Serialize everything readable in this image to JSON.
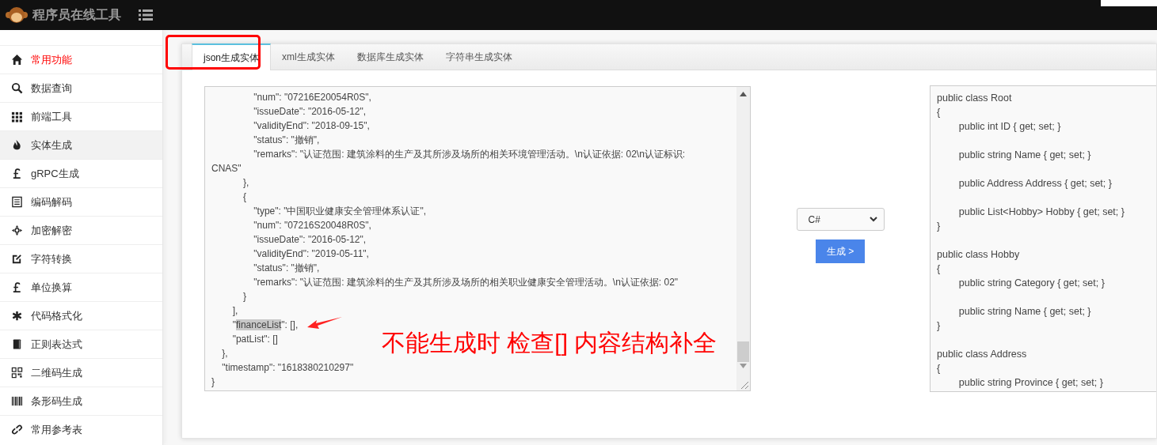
{
  "header": {
    "title": "程序员在线工具"
  },
  "sidebar": {
    "items": [
      {
        "label": "常用功能",
        "kind": "category",
        "selected": false
      },
      {
        "label": "数据查询",
        "kind": "link",
        "selected": false
      },
      {
        "label": "前端工具",
        "kind": "link",
        "selected": false
      },
      {
        "label": "实体生成",
        "kind": "link",
        "selected": true
      },
      {
        "label": "gRPC生成",
        "kind": "link",
        "selected": false
      },
      {
        "label": "编码解码",
        "kind": "link",
        "selected": false
      },
      {
        "label": "加密解密",
        "kind": "link",
        "selected": false
      },
      {
        "label": "字符转换",
        "kind": "link",
        "selected": false
      },
      {
        "label": "单位换算",
        "kind": "link",
        "selected": false
      },
      {
        "label": "代码格式化",
        "kind": "link",
        "selected": false
      },
      {
        "label": "正则表达式",
        "kind": "link",
        "selected": false
      },
      {
        "label": "二维码生成",
        "kind": "link",
        "selected": false
      },
      {
        "label": "条形码生成",
        "kind": "link",
        "selected": false
      },
      {
        "label": "常用参考表",
        "kind": "link",
        "selected": false
      }
    ]
  },
  "tabs": [
    {
      "label": "json生成实体",
      "selected": true
    },
    {
      "label": "xml生成实体",
      "selected": false
    },
    {
      "label": "数据库生成实体",
      "selected": false
    },
    {
      "label": "字符串生成实体",
      "selected": false
    }
  ],
  "input_editor": {
    "lines": [
      {
        "text": "                \"num\": \"07216E20054R0S\","
      },
      {
        "text": "                \"issueDate\": \"2016-05-12\","
      },
      {
        "text": "                \"validityEnd\": \"2018-09-15\","
      },
      {
        "text": "                \"status\": \"撤销\","
      },
      {
        "text": "                \"remarks\": \"认证范围: 建筑涂料的生产及其所涉及场所的相关环境管理活动。\\n认证依据: 02\\n认证标识:"
      },
      {
        "text": "CNAS\""
      },
      {
        "text": "            },"
      },
      {
        "text": "            {"
      },
      {
        "text": "                \"type\": \"中国职业健康安全管理体系认证\","
      },
      {
        "text": "                \"num\": \"07216S20048R0S\","
      },
      {
        "text": "                \"issueDate\": \"2016-05-12\","
      },
      {
        "text": "                \"validityEnd\": \"2019-05-11\","
      },
      {
        "text": "                \"status\": \"撤销\","
      },
      {
        "text": "                \"remarks\": \"认证范围: 建筑涂料的生产及其所涉及场所的相关职业健康安全管理活动。\\n认证依据: 02\""
      },
      {
        "text": "            }"
      },
      {
        "text": "        ],"
      },
      {
        "text": "        \"",
        "selected_text": "financeList",
        "after": "\": [],"
      },
      {
        "text": "        \"patList\": []"
      },
      {
        "text": "    },"
      },
      {
        "text": "    \"timestamp\": \"1618380210297\""
      },
      {
        "text": "}"
      }
    ]
  },
  "language_select": {
    "value": "C#"
  },
  "generate_button": {
    "label": "生成 >"
  },
  "output": {
    "blocks": [
      {
        "lines": [
          "public class Root",
          "{",
          "        public int ID { get; set; }"
        ]
      },
      {
        "lines": [
          "        public string Name { get; set; }"
        ]
      },
      {
        "lines": [
          "        public Address Address { get; set; }"
        ]
      },
      {
        "lines": [
          "        public List<Hobby> Hobby { get; set; }",
          "}"
        ]
      },
      {
        "lines": [
          "public class Hobby",
          "{",
          "        public string Category { get; set; }"
        ]
      },
      {
        "lines": [
          "        public string Name { get; set; }",
          "}"
        ]
      },
      {
        "lines": [
          "public class Address",
          "{",
          "        public string Province { get; set; }"
        ]
      }
    ]
  },
  "annotation": {
    "text": "不能生成时 检查[] 内容结构补全"
  }
}
